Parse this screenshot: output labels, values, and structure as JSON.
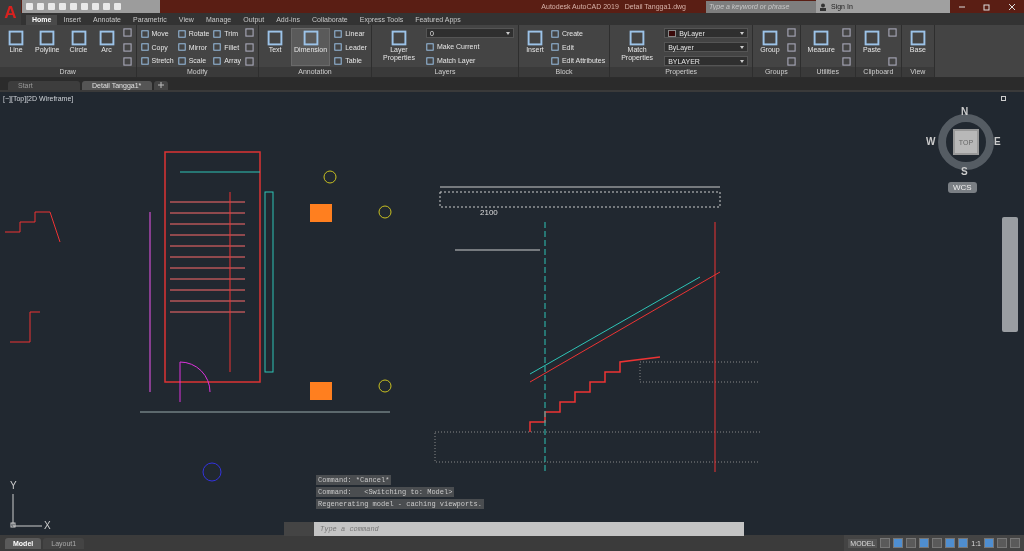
{
  "app_button": {
    "label": "A"
  },
  "title_bar": {
    "title": "Autodesk AutoCAD 2019",
    "document": "Detail Tangga1.dwg",
    "search": {
      "placeholder": "Type a keyword or phrase"
    },
    "sign_in": "Sign In"
  },
  "ribbon_tabs": [
    {
      "label": "Home",
      "selected": true
    },
    {
      "label": "Insert",
      "selected": false
    },
    {
      "label": "Annotate",
      "selected": false
    },
    {
      "label": "Parametric",
      "selected": false
    },
    {
      "label": "View",
      "selected": false
    },
    {
      "label": "Manage",
      "selected": false
    },
    {
      "label": "Output",
      "selected": false
    },
    {
      "label": "Add-ins",
      "selected": false
    },
    {
      "label": "Collaborate",
      "selected": false
    },
    {
      "label": "Express Tools",
      "selected": false
    },
    {
      "label": "Featured Apps",
      "selected": false
    }
  ],
  "panels": [
    {
      "title": "Draw",
      "columns": [
        [
          {
            "kind": "large",
            "label": "Line"
          }
        ],
        [
          {
            "kind": "large",
            "label": "Polyline"
          }
        ],
        [
          {
            "kind": "large",
            "label": "Circle"
          }
        ],
        [
          {
            "kind": "large",
            "label": "Arc"
          }
        ],
        [
          {
            "kind": "icon"
          },
          {
            "kind": "icon"
          },
          {
            "kind": "icon"
          }
        ]
      ]
    },
    {
      "title": "Modify",
      "columns": [
        [
          {
            "kind": "small",
            "label": "Move"
          },
          {
            "kind": "small",
            "label": "Copy"
          },
          {
            "kind": "small",
            "label": "Stretch"
          }
        ],
        [
          {
            "kind": "small",
            "label": "Rotate"
          },
          {
            "kind": "small",
            "label": "Mirror"
          },
          {
            "kind": "small",
            "label": "Scale"
          }
        ],
        [
          {
            "kind": "small",
            "label": "Trim"
          },
          {
            "kind": "small",
            "label": "Fillet"
          },
          {
            "kind": "small",
            "label": "Array"
          }
        ],
        [
          {
            "kind": "icon"
          },
          {
            "kind": "icon"
          },
          {
            "kind": "icon"
          }
        ]
      ]
    },
    {
      "title": "Annotation",
      "columns": [
        [
          {
            "kind": "large",
            "label": "Text",
            "selected": false
          }
        ],
        [
          {
            "kind": "large",
            "label": "Dimension",
            "selected": true
          }
        ],
        [
          {
            "kind": "small",
            "label": "Linear"
          },
          {
            "kind": "small",
            "label": "Leader"
          },
          {
            "kind": "small",
            "label": "Table"
          }
        ]
      ]
    },
    {
      "title": "Layers",
      "columns": [
        [
          {
            "kind": "large",
            "label": "Layer Properties"
          }
        ],
        [
          {
            "kind": "combo",
            "label": "0"
          },
          {
            "kind": "small",
            "label": "Make Current"
          },
          {
            "kind": "small",
            "label": "Match Layer"
          }
        ]
      ]
    },
    {
      "title": "Block",
      "columns": [
        [
          {
            "kind": "large",
            "label": "Insert"
          }
        ],
        [
          {
            "kind": "small",
            "label": "Create"
          },
          {
            "kind": "small",
            "label": "Edit"
          },
          {
            "kind": "small",
            "label": "Edit Attributes"
          }
        ]
      ]
    },
    {
      "title": "Properties",
      "columns": [
        [
          {
            "kind": "large",
            "label": "Match Properties"
          }
        ],
        [
          {
            "kind": "combo",
            "label": "ByLayer",
            "color": "#3a0a0a"
          },
          {
            "kind": "combo",
            "label": "ByLayer"
          },
          {
            "kind": "combo",
            "label": "BYLAYER"
          }
        ]
      ]
    },
    {
      "title": "Groups",
      "columns": [
        [
          {
            "kind": "large",
            "label": "Group"
          }
        ],
        [
          {
            "kind": "icon"
          },
          {
            "kind": "icon"
          },
          {
            "kind": "icon"
          }
        ]
      ]
    },
    {
      "title": "Utilities",
      "columns": [
        [
          {
            "kind": "large",
            "label": "Measure"
          }
        ],
        [
          {
            "kind": "icon"
          },
          {
            "kind": "icon"
          },
          {
            "kind": "icon"
          }
        ]
      ]
    },
    {
      "title": "Clipboard",
      "columns": [
        [
          {
            "kind": "large",
            "label": "Paste"
          }
        ],
        [
          {
            "kind": "icon"
          },
          {
            "kind": "icon"
          }
        ]
      ]
    },
    {
      "title": "View",
      "columns": [
        [
          {
            "kind": "large",
            "label": "Base"
          }
        ]
      ]
    }
  ],
  "file_tabs": [
    {
      "label": "Start",
      "selected": false
    },
    {
      "label": "Detail Tangga1*",
      "selected": true
    }
  ],
  "viewport": {
    "label": "[−][Top][2D Wireframe]",
    "dimension": "2100",
    "viewcube": {
      "north": "N",
      "south": "S",
      "east": "E",
      "west": "W",
      "face": "TOP",
      "ucs": "WCS"
    },
    "axes": {
      "x": "X",
      "y": "Y"
    }
  },
  "command_line": {
    "history": [
      "Command: *Cancel*",
      "Command:   <Switching to: Model>",
      "Regenerating model - caching viewports."
    ],
    "placeholder": "Type a command"
  },
  "layout_tabs": [
    {
      "label": "Model",
      "selected": true
    },
    {
      "label": "Layout1",
      "selected": false
    }
  ],
  "status_bar": {
    "mode": "MODEL",
    "scale": "1:1",
    "toggles": [
      {
        "on": false
      },
      {
        "on": true
      },
      {
        "on": false
      },
      {
        "on": true
      },
      {
        "on": false
      },
      {
        "on": true
      },
      {
        "on": true
      },
      {
        "on": true
      },
      {
        "on": false
      },
      {
        "on": false
      }
    ]
  }
}
